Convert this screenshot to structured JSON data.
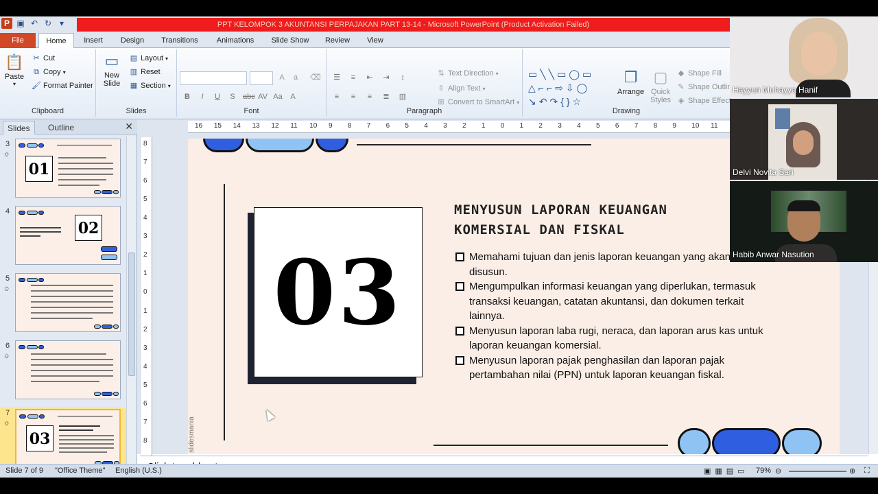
{
  "window": {
    "title": "PPT KELOMPOK 3 AKUNTANSI PERPAJAKAN PART 13-14  -  Microsoft PowerPoint (Product Activation Failed)"
  },
  "ribbon": {
    "tabs": [
      "File",
      "Home",
      "Insert",
      "Design",
      "Transitions",
      "Animations",
      "Slide Show",
      "Review",
      "View"
    ],
    "clipboard": {
      "paste": "Paste",
      "cut": "Cut",
      "copy": "Copy",
      "format_painter": "Format Painter",
      "label": "Clipboard"
    },
    "slides": {
      "new_slide_1": "New",
      "new_slide_2": "Slide",
      "layout": "Layout",
      "reset": "Reset",
      "section": "Section",
      "label": "Slides"
    },
    "font": {
      "label": "Font"
    },
    "paragraph": {
      "text_direction": "Text Direction",
      "align_text": "Align Text",
      "convert_smartart": "Convert to SmartArt",
      "label": "Paragraph"
    },
    "drawing": {
      "arrange": "Arrange",
      "quick_1": "Quick",
      "quick_2": "Styles",
      "shape_fill": "Shape Fill",
      "shape_outline": "Shape Outlin",
      "shape_effects": "Shape Effect",
      "label": "Drawing"
    }
  },
  "panel": {
    "tabs": [
      "Slides",
      "Outline"
    ],
    "slide_numbers": [
      "3",
      "4",
      "5",
      "6",
      "7"
    ],
    "thumb_numbers": [
      "01",
      "02",
      "03"
    ]
  },
  "ruler": {
    "horizontal": [
      "16",
      "15",
      "14",
      "13",
      "12",
      "11",
      "10",
      "9",
      "8",
      "7",
      "6",
      "5",
      "4",
      "3",
      "2",
      "1",
      "0",
      "1",
      "2",
      "3",
      "4",
      "5",
      "6",
      "7",
      "8",
      "9",
      "10",
      "11"
    ],
    "vertical": [
      "8",
      "7",
      "6",
      "5",
      "4",
      "3",
      "2",
      "1",
      "0",
      "1",
      "2",
      "3",
      "4",
      "5",
      "6",
      "7",
      "8"
    ]
  },
  "slide": {
    "number": "03",
    "title": "MENYUSUN LAPORAN KEUANGAN KOMERSIAL DAN FISKAL",
    "bullets": [
      "Memahami tujuan dan jenis laporan keuangan yang akan disusun.",
      "Mengumpulkan informasi keuangan yang diperlukan, termasuk transaksi keuangan, catatan akuntansi, dan dokumen terkait lainnya.",
      "Menyusun laporan laba rugi, neraca, dan laporan arus kas untuk laporan keuangan komersial.",
      "Menyusun laporan pajak penghasilan dan laporan pajak pertambahan nilai (PPN) untuk laporan keuangan fiskal."
    ],
    "watermark": "slidesmania"
  },
  "notes": {
    "placeholder": "Click to add notes"
  },
  "status": {
    "slide": "Slide 7 of 9",
    "theme": "\"Office Theme\"",
    "language": "English (U.S.)",
    "zoom": "79%"
  },
  "participants": [
    {
      "name": "Hayyun Muhayya Hanif"
    },
    {
      "name": "Delvi Novita Sari"
    },
    {
      "name": "Habib Anwar Nasution"
    }
  ]
}
